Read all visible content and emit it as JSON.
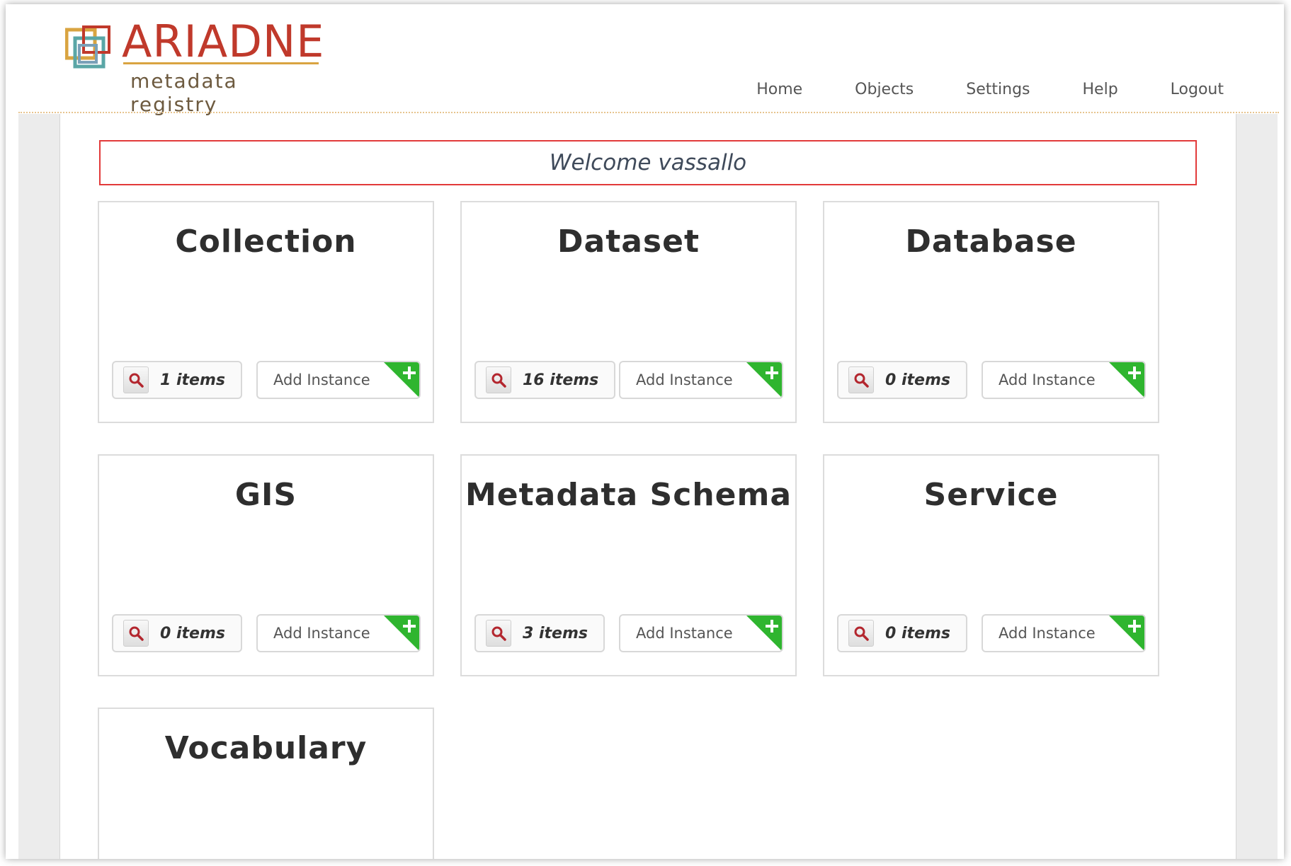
{
  "logo": {
    "title": "ARIADNE",
    "subtitle": "metadata registry"
  },
  "nav": [
    "Home",
    "Objects",
    "Settings",
    "Help",
    "Logout"
  ],
  "welcome": "Welcome vassallo",
  "cards": [
    {
      "title": "Collection",
      "items": "1 items",
      "add": "Add Instance"
    },
    {
      "title": "Dataset",
      "items": "16 items",
      "add": "Add Instance"
    },
    {
      "title": "Database",
      "items": "0 items",
      "add": "Add Instance"
    },
    {
      "title": "GIS",
      "items": "0 items",
      "add": "Add Instance"
    },
    {
      "title": "Metadata Schema",
      "items": "3 items",
      "add": "Add Instance"
    },
    {
      "title": "Service",
      "items": "0 items",
      "add": "Add Instance"
    },
    {
      "title": "Vocabulary"
    }
  ],
  "colors": {
    "accent_red": "#c0392b",
    "welcome_border": "#e23a3a",
    "add_green": "#2fb52f",
    "logo_gold": "#d9a441"
  }
}
